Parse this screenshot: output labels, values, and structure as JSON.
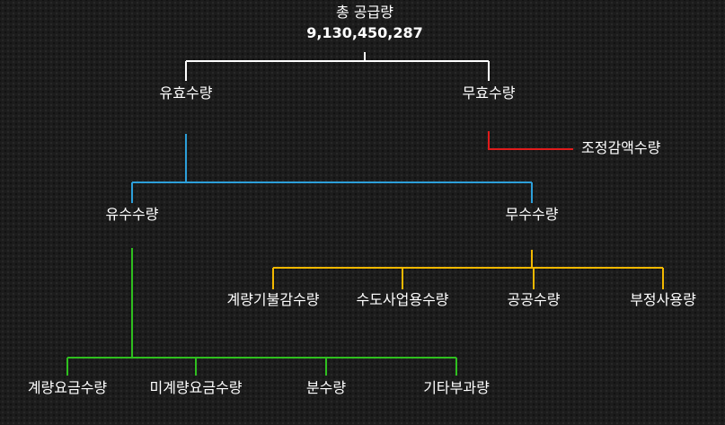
{
  "root": {
    "label": "총 공급량",
    "value": "9,130,450,287"
  },
  "level1": {
    "revenue": "유효수량",
    "non_revenue": "무효수량"
  },
  "non_revenue_branch": {
    "adjustment": "조정감액수량"
  },
  "level2": {
    "billed": "유수수량",
    "unbilled": "무수수량"
  },
  "unbilled_items": [
    "계량기불감수량",
    "수도사업용수량",
    "공공수량",
    "부정사용량"
  ],
  "billed_items": [
    "계량요금수량",
    "미계량요금수량",
    "분수량",
    "기타부과량"
  ],
  "colors": {
    "root_connector": "#ffffff",
    "revenue_connector": "#2d9fd9",
    "non_revenue_connector": "#e01b1b",
    "unbilled_connector": "#f2b800",
    "billed_connector": "#2fbf1f",
    "background": "#1c1c1c",
    "text": "#ffffff"
  }
}
